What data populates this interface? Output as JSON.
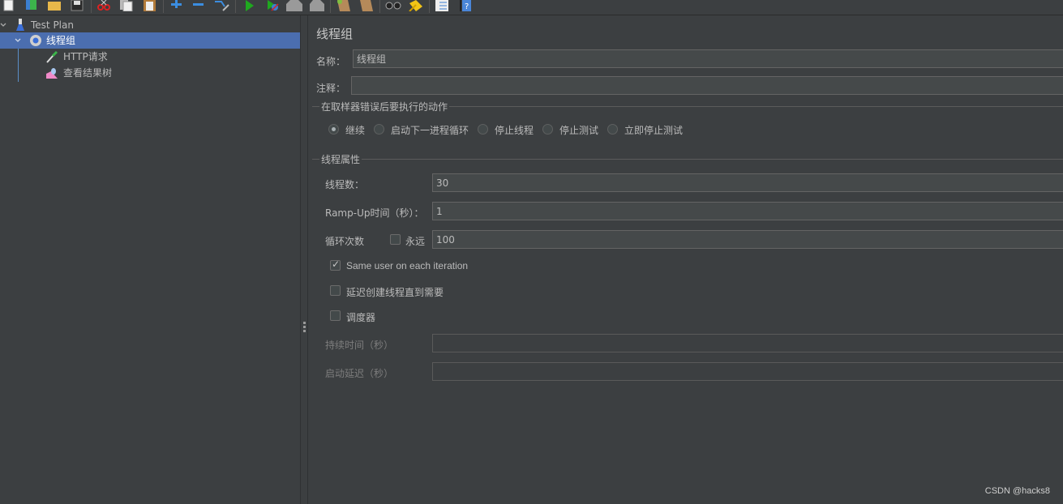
{
  "toolbar": {
    "icons": [
      "new-icon",
      "templates-icon",
      "open-icon",
      "save-icon",
      "cut-icon",
      "copy-icon",
      "paste-icon",
      "expand-icon",
      "collapse-icon",
      "toggle-icon",
      "start-icon",
      "start-no-pause-icon",
      "stop-icon",
      "shutdown-icon",
      "clear-icon",
      "clear-all-icon",
      "search-icon",
      "reset-search-icon",
      "function-helper-icon",
      "help-icon"
    ]
  },
  "tree": {
    "items": [
      {
        "label": "Test Plan",
        "icon": "test-plan-icon",
        "expanded": true,
        "level": 0
      },
      {
        "label": "线程组",
        "icon": "thread-group-icon",
        "expanded": true,
        "level": 1,
        "selected": true
      },
      {
        "label": "HTTP请求",
        "icon": "http-sampler-icon",
        "level": 2
      },
      {
        "label": "查看结果树",
        "icon": "result-tree-icon",
        "level": 2
      }
    ]
  },
  "panel": {
    "title": "线程组",
    "name_label": "名称：",
    "name_value": "线程组",
    "comment_label": "注释：",
    "comment_value": "",
    "error_action": {
      "title": "在取样器错误后要执行的动作",
      "options": [
        "继续",
        "启动下一进程循环",
        "停止线程",
        "停止测试",
        "立即停止测试"
      ],
      "selected": "继续"
    },
    "thread_props": {
      "title": "线程属性",
      "threads_label": "线程数：",
      "threads_value": "30",
      "rampup_label": "Ramp-Up时间（秒）：",
      "rampup_value": "1",
      "loop_label": "循环次数",
      "forever_label": "永远",
      "forever_checked": false,
      "loop_value": "100",
      "same_user_label": "Same user on each iteration",
      "same_user_checked": true,
      "delay_create_label": "延迟创建线程直到需要",
      "delay_create_checked": false,
      "scheduler_label": "调度器",
      "scheduler_checked": false,
      "duration_label": "持续时间（秒）",
      "duration_value": "",
      "startup_delay_label": "启动延迟（秒）",
      "startup_delay_value": ""
    }
  },
  "watermark": "CSDN @hacks8"
}
